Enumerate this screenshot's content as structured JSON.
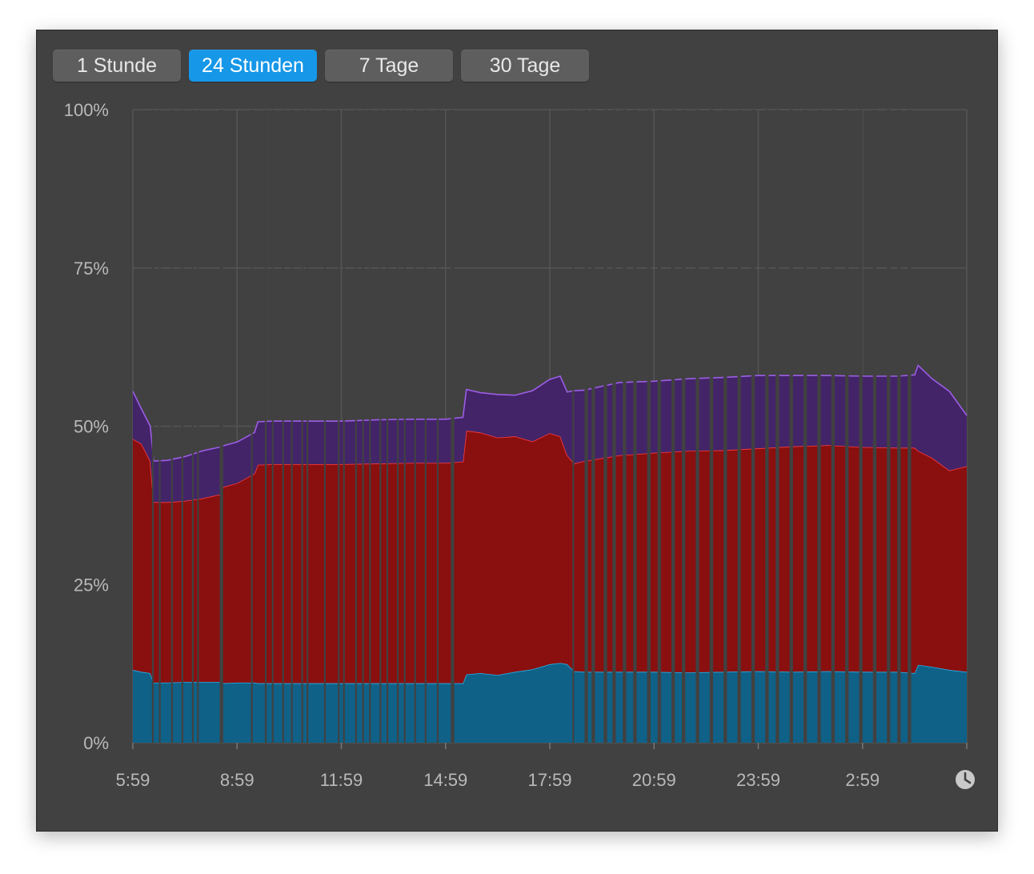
{
  "tabs": [
    {
      "label": "1 Stunde",
      "active": false
    },
    {
      "label": "24 Stunden",
      "active": true
    },
    {
      "label": "7 Tage",
      "active": false
    },
    {
      "label": "30 Tage",
      "active": false
    }
  ],
  "icons": {
    "time": "clock-icon"
  },
  "colors": {
    "accent": "#1697e8",
    "background": "#414141",
    "blue_series": "#0f6188",
    "blue_line": "#22b4ea",
    "red_series": "#8a0f0f",
    "red_line": "#ff3b3b",
    "purple_series": "#432468",
    "purple_line": "#9b5de5"
  },
  "chart_data": {
    "type": "area",
    "stacked": true,
    "title": "",
    "xlabel": "",
    "ylabel": "",
    "ylim": [
      0,
      100
    ],
    "yticks": [
      "0%",
      "25%",
      "50%",
      "75%",
      "100%"
    ],
    "ytick_values": [
      0,
      25,
      50,
      75,
      100
    ],
    "xticks": [
      "5:59",
      "8:59",
      "11:59",
      "14:59",
      "17:59",
      "20:59",
      "23:59",
      "2:59"
    ],
    "xtick_values": [
      0,
      3,
      6,
      9,
      12,
      15,
      18,
      21
    ],
    "xlim": [
      0,
      24
    ],
    "grid": true,
    "legend": "none",
    "x": [
      0,
      0.25,
      0.5,
      0.6,
      1,
      1.5,
      2,
      2.5,
      2.6,
      3,
      3.5,
      3.6,
      4,
      4.5,
      5,
      6,
      7,
      8,
      9,
      9.5,
      9.6,
      10,
      10.5,
      11,
      11.5,
      12,
      12.3,
      12.5,
      12.7,
      13,
      14,
      15,
      16,
      17,
      18,
      19,
      20,
      21,
      22,
      22.5,
      22.6,
      23,
      23.5,
      24
    ],
    "series": [
      {
        "values": [
          11.5,
          11.2,
          11.0,
          9.5,
          9.5,
          9.6,
          9.6,
          9.6,
          9.4,
          9.5,
          9.5,
          9.4,
          9.4,
          9.4,
          9.4,
          9.4,
          9.4,
          9.4,
          9.4,
          9.4,
          10.8,
          11.0,
          10.7,
          11.2,
          11.6,
          12.4,
          12.6,
          12.4,
          11.3,
          11.2,
          11.2,
          11.2,
          11.1,
          11.2,
          11.3,
          11.2,
          11.3,
          11.2,
          11.2,
          11.0,
          12.3,
          12.0,
          11.5,
          11.2
        ]
      },
      {
        "values": [
          36.5,
          36.0,
          33.5,
          28.5,
          28.5,
          28.6,
          29.0,
          29.6,
          31.0,
          31.5,
          33.0,
          34.5,
          34.6,
          34.6,
          34.6,
          34.6,
          34.7,
          34.8,
          34.8,
          35.0,
          38.5,
          38.0,
          37.5,
          37.2,
          36.0,
          36.5,
          35.8,
          33.0,
          32.8,
          33.3,
          34.2,
          34.6,
          35.0,
          35.0,
          35.2,
          35.6,
          35.7,
          35.5,
          35.4,
          35.6,
          33.8,
          33.0,
          31.5,
          32.5
        ]
      },
      {
        "values": [
          7.5,
          5.5,
          5.5,
          6.5,
          6.6,
          7.0,
          7.5,
          7.5,
          6.5,
          6.5,
          6.5,
          6.8,
          6.8,
          6.8,
          6.8,
          6.8,
          6.9,
          6.9,
          6.9,
          7.0,
          6.5,
          6.3,
          6.8,
          6.5,
          8.0,
          8.5,
          9.5,
          10.0,
          11.5,
          11.2,
          11.5,
          11.3,
          11.4,
          11.5,
          11.5,
          11.2,
          11.0,
          11.2,
          11.3,
          11.5,
          13.5,
          12.5,
          12.5,
          8.0
        ]
      }
    ],
    "gap_intervals": [
      [
        0.55,
        0.6
      ],
      [
        0.75,
        0.8
      ],
      [
        1.1,
        1.15
      ],
      [
        1.4,
        1.45
      ],
      [
        1.7,
        1.75
      ],
      [
        1.85,
        1.9
      ],
      [
        2.5,
        2.6
      ],
      [
        3.4,
        3.45
      ],
      [
        3.8,
        3.85
      ],
      [
        4.0,
        4.05
      ],
      [
        4.3,
        4.35
      ],
      [
        4.55,
        4.6
      ],
      [
        4.85,
        4.9
      ],
      [
        5.0,
        5.05
      ],
      [
        5.5,
        5.55
      ],
      [
        5.9,
        5.95
      ],
      [
        6.05,
        6.1
      ],
      [
        6.4,
        6.45
      ],
      [
        6.6,
        6.65
      ],
      [
        6.8,
        6.85
      ],
      [
        7.1,
        7.15
      ],
      [
        7.3,
        7.35
      ],
      [
        7.6,
        7.65
      ],
      [
        7.8,
        7.85
      ],
      [
        8.1,
        8.15
      ],
      [
        8.4,
        8.45
      ],
      [
        8.75,
        8.8
      ],
      [
        9.15,
        9.25
      ],
      [
        12.65,
        12.7
      ],
      [
        13.0,
        13.1
      ],
      [
        13.2,
        13.3
      ],
      [
        13.55,
        13.65
      ],
      [
        13.8,
        13.9
      ],
      [
        14.1,
        14.2
      ],
      [
        14.4,
        14.5
      ],
      [
        14.8,
        14.9
      ],
      [
        15.1,
        15.2
      ],
      [
        15.5,
        15.6
      ],
      [
        15.8,
        15.9
      ],
      [
        16.2,
        16.3
      ],
      [
        16.6,
        16.7
      ],
      [
        17.0,
        17.1
      ],
      [
        17.4,
        17.5
      ],
      [
        17.8,
        17.9
      ],
      [
        18.2,
        18.3
      ],
      [
        18.5,
        18.6
      ],
      [
        18.9,
        19.0
      ],
      [
        19.3,
        19.4
      ],
      [
        19.7,
        19.8
      ],
      [
        20.1,
        20.2
      ],
      [
        20.5,
        20.6
      ],
      [
        20.9,
        21.0
      ],
      [
        21.3,
        21.4
      ],
      [
        21.7,
        21.8
      ],
      [
        22.0,
        22.1
      ],
      [
        22.3,
        22.4
      ]
    ]
  }
}
